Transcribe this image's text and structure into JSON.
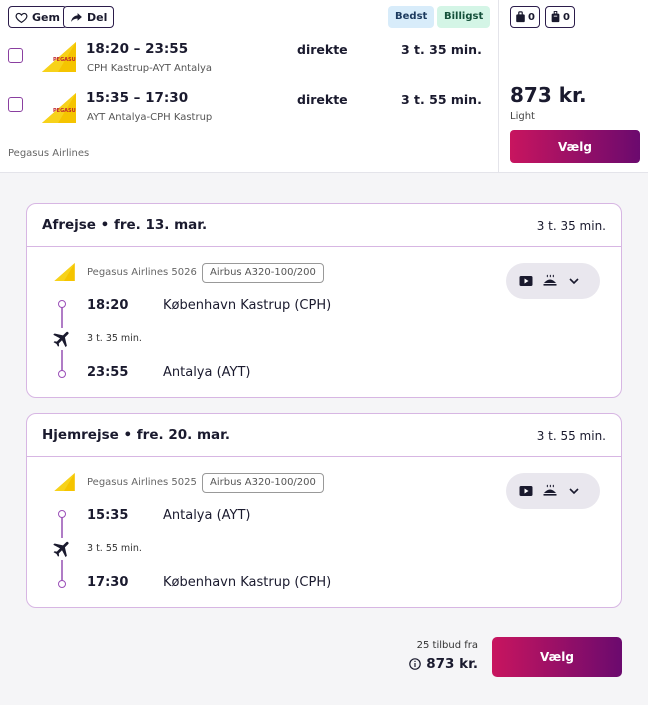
{
  "actions": {
    "save_label": "Gem",
    "share_label": "Del"
  },
  "tags": {
    "best": "Bedst",
    "cheapest": "Billigst"
  },
  "baggage": {
    "cabin_count": "0",
    "checked_count": "0"
  },
  "itinerary": [
    {
      "times": "18:20 – 23:55",
      "route": "CPH Kastrup-AYT Antalya",
      "stops": "direkte",
      "duration": "3 t. 35 min."
    },
    {
      "times": "15:35 – 17:30",
      "route": "AYT Antalya-CPH Kastrup",
      "stops": "direkte",
      "duration": "3 t. 55 min."
    }
  ],
  "airline_name": "Pegasus Airlines",
  "price": "873 kr.",
  "fare_type": "Light",
  "select_label": "Vælg",
  "legs": [
    {
      "title": "Afrejse • fre. 13. mar.",
      "duration": "3 t. 35 min.",
      "flight": "Pegasus Airlines 5026",
      "aircraft": "Airbus A320-100/200",
      "depart_time": "18:20",
      "depart_place": "København Kastrup (CPH)",
      "flight_duration": "3 t. 35 min.",
      "arrive_time": "23:55",
      "arrive_place": "Antalya (AYT)"
    },
    {
      "title": "Hjemrejse • fre. 20. mar.",
      "duration": "3 t. 55 min.",
      "flight": "Pegasus Airlines 5025",
      "aircraft": "Airbus A320-100/200",
      "depart_time": "15:35",
      "depart_place": "Antalya (AYT)",
      "flight_duration": "3 t. 55 min.",
      "arrive_time": "17:30",
      "arrive_place": "København Kastrup (CPH)"
    }
  ],
  "footer": {
    "offers": "25 tilbud fra",
    "price": "873 kr.",
    "select_label": "Vælg"
  },
  "icons": [
    "heart-icon",
    "share-arrow-icon",
    "cabin-bag-icon",
    "checked-bag-icon",
    "pegasus-logo-icon",
    "video-icon",
    "meal-icon",
    "chevron-down-icon",
    "plane-icon",
    "info-icon"
  ],
  "colors": {
    "accent_start": "#c8155f",
    "accent_end": "#6b0a6e",
    "timeline": "#9b4fb8",
    "card_border": "#d7b6e3"
  }
}
